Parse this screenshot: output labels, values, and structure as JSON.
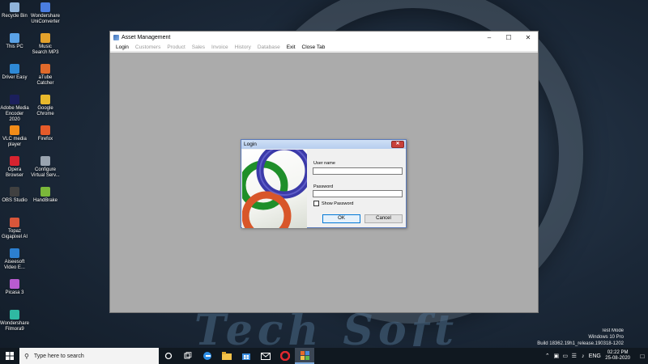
{
  "desktop": {
    "icons": [
      {
        "label": "Recycle Bin",
        "color": "#8fb3d9"
      },
      {
        "label": "Wondershare UniConverter",
        "color": "#4a7de0"
      },
      {
        "label": "This PC",
        "color": "#5aa2e6"
      },
      {
        "label": "Music Search MP3",
        "color": "#e3a12b"
      },
      {
        "label": "Driver Easy",
        "color": "#2e89d6"
      },
      {
        "label": "aTube Catcher",
        "color": "#e06a2b"
      },
      {
        "label": "Adobe Media Encoder 2020",
        "color": "#1b1f5c"
      },
      {
        "label": "Google Chrome",
        "color": "#e8b92c"
      },
      {
        "label": "VLC media player",
        "color": "#f28c18"
      },
      {
        "label": "Firefox",
        "color": "#e65b2a"
      },
      {
        "label": "Opera Browser",
        "color": "#d8232f"
      },
      {
        "label": "Configure Virtual Serv...",
        "color": "#9aa4b0"
      },
      {
        "label": "OBS Studio",
        "color": "#404040"
      },
      {
        "label": "HandBrake",
        "color": "#7bb83a"
      },
      {
        "label": "Topaz Gigapixel AI",
        "color": "#d8563a"
      },
      {
        "label": "Aiseesoft Video E...",
        "color": "#2c7fd0"
      },
      {
        "label": "Picasa 3",
        "color": "#b85bd0"
      },
      {
        "label": "Wondershare Filmora9",
        "color": "#2fb9a2"
      }
    ]
  },
  "app": {
    "title": "Asset Management",
    "menu": [
      {
        "label": "Login",
        "enabled": true
      },
      {
        "label": "Customers",
        "enabled": false
      },
      {
        "label": "Product",
        "enabled": false
      },
      {
        "label": "Sales",
        "enabled": false
      },
      {
        "label": "Invoice",
        "enabled": false
      },
      {
        "label": "History",
        "enabled": false
      },
      {
        "label": "Database",
        "enabled": false
      },
      {
        "label": "Exit",
        "enabled": true
      },
      {
        "label": "Close Tab",
        "enabled": true
      }
    ]
  },
  "login": {
    "title": "Login",
    "username_label": "User name",
    "username_value": "",
    "password_label": "Password",
    "password_value": "",
    "show_password_label": "Show Password",
    "show_password_checked": false,
    "ok_label": "OK",
    "cancel_label": "Cancel"
  },
  "watermark": {
    "line1": "Test Mode",
    "line2": "Windows 10 Pro",
    "line3": "Build 18362.19h1_release.190318-1202"
  },
  "taskbar": {
    "search_placeholder": "Type here to search",
    "language": "ENG",
    "time": "02:22 PM",
    "date": "25-08-2020"
  }
}
